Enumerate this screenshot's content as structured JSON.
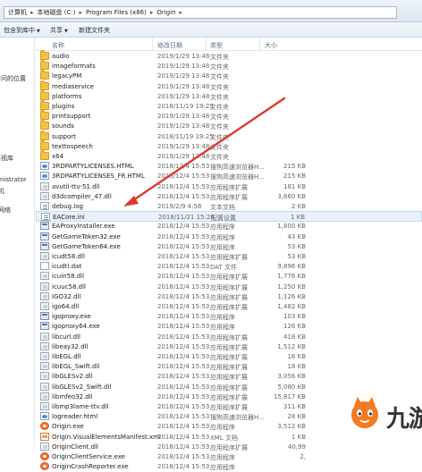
{
  "address_bar": {
    "segments": [
      "计算机",
      "本地磁盘 (C:)",
      "Program Files (x86)",
      "Origin"
    ]
  },
  "toolbar": {
    "items": [
      {
        "label": "包含到库中",
        "dropdown": true
      },
      {
        "label": "共享",
        "dropdown": true
      },
      {
        "label": "新建文件夹",
        "dropdown": false
      }
    ]
  },
  "nav": {
    "items": [
      "访问的位置",
      "影视库",
      "inistrator",
      "机",
      "网络"
    ]
  },
  "columns": {
    "name": "名称",
    "date": "修改日期",
    "type": "类型",
    "size": "大小"
  },
  "files": [
    {
      "name": "audio",
      "date": "2019/1/29 13:48",
      "type": "文件夹",
      "size": "",
      "icon": "folder-icon"
    },
    {
      "name": "imageformats",
      "date": "2019/1/29 13:48",
      "type": "文件夹",
      "size": "",
      "icon": "folder-icon"
    },
    {
      "name": "legacyPM",
      "date": "2019/1/29 13:48",
      "type": "文件夹",
      "size": "",
      "icon": "folder-icon"
    },
    {
      "name": "mediaservice",
      "date": "2019/1/29 13:48",
      "type": "文件夹",
      "size": "",
      "icon": "folder-icon"
    },
    {
      "name": "platforms",
      "date": "2019/1/29 13:48",
      "type": "文件夹",
      "size": "",
      "icon": "folder-icon"
    },
    {
      "name": "plugins",
      "date": "2018/11/19 19:25",
      "type": "文件夹",
      "size": "",
      "icon": "folder-icon"
    },
    {
      "name": "printsupport",
      "date": "2019/1/29 13:48",
      "type": "文件夹",
      "size": "",
      "icon": "folder-icon"
    },
    {
      "name": "sounds",
      "date": "2019/1/29 13:48",
      "type": "文件夹",
      "size": "",
      "icon": "folder-icon"
    },
    {
      "name": "support",
      "date": "2018/11/19 19:25",
      "type": "文件夹",
      "size": "",
      "icon": "folder-icon"
    },
    {
      "name": "texttospeech",
      "date": "2019/1/29 13:48",
      "type": "文件夹",
      "size": "",
      "icon": "folder-icon"
    },
    {
      "name": "x64",
      "date": "2019/1/29 13:48",
      "type": "文件夹",
      "size": "",
      "icon": "folder-icon"
    },
    {
      "name": "3RDPARTYLICENSES.HTML",
      "date": "2018/12/4 15:53",
      "type": "搜狗高速浏览器H...",
      "size": "215 KB",
      "icon": "html-icon"
    },
    {
      "name": "3RDPARTYLICENSES_FR.HTML",
      "date": "2018/12/4 15:53",
      "type": "搜狗高速浏览器H...",
      "size": "215 KB",
      "icon": "html-icon"
    },
    {
      "name": "avutil-ttv-51.dll",
      "date": "2018/12/4 15:53",
      "type": "应用程序扩展",
      "size": "181 KB",
      "icon": "dll-icon"
    },
    {
      "name": "d3dcompiler_47.dll",
      "date": "2018/12/4 15:53",
      "type": "应用程序扩展",
      "size": "3,660 KB",
      "icon": "dll-icon"
    },
    {
      "name": "debug.log",
      "date": "2019/2/9 4:58",
      "type": "文本文档",
      "size": "2 KB",
      "icon": "log-icon"
    },
    {
      "name": "EACore.ini",
      "date": "2018/11/21 15:28",
      "type": "配置设置",
      "size": "1 KB",
      "icon": "ini-icon"
    },
    {
      "name": "EAProxyInstaller.exe",
      "date": "2018/12/4 15:53",
      "type": "应用程序",
      "size": "1,800 KB",
      "icon": "exe-icon"
    },
    {
      "name": "GetGameToken32.exe",
      "date": "2018/12/4 15:53",
      "type": "应用程序",
      "size": "43 KB",
      "icon": "exe-icon"
    },
    {
      "name": "GetGameToken64.exe",
      "date": "2018/12/4 15:53",
      "type": "应用程序",
      "size": "53 KB",
      "icon": "exe-icon"
    },
    {
      "name": "icudt58.dll",
      "date": "2018/12/4 15:53",
      "type": "应用程序扩展",
      "size": "53 KB",
      "icon": "dll-icon"
    },
    {
      "name": "icudtl.dat",
      "date": "2018/12/4 15:53",
      "type": "DAT 文件",
      "size": "9,896 KB",
      "icon": "dat-icon"
    },
    {
      "name": "icuin58.dll",
      "date": "2018/12/4 15:53",
      "type": "应用程序扩展",
      "size": "1,776 KB",
      "icon": "dll-icon"
    },
    {
      "name": "icuuc58.dll",
      "date": "2018/12/4 15:53",
      "type": "应用程序扩展",
      "size": "1,250 KB",
      "icon": "dll-icon"
    },
    {
      "name": "IGO32.dll",
      "date": "2018/12/4 15:53",
      "type": "应用程序扩展",
      "size": "1,126 KB",
      "icon": "dll-icon"
    },
    {
      "name": "igo64.dll",
      "date": "2018/12/4 15:53",
      "type": "应用程序扩展",
      "size": "1,482 KB",
      "icon": "dll-icon"
    },
    {
      "name": "igoproxy.exe",
      "date": "2018/12/4 15:53",
      "type": "应用程序",
      "size": "103 KB",
      "icon": "exe-icon"
    },
    {
      "name": "igoproxy64.exe",
      "date": "2018/12/4 15:53",
      "type": "应用程序",
      "size": "126 KB",
      "icon": "exe-icon"
    },
    {
      "name": "libcurl.dll",
      "date": "2018/12/4 15:53",
      "type": "应用程序扩展",
      "size": "418 KB",
      "icon": "dll-icon"
    },
    {
      "name": "libeay32.dll",
      "date": "2018/12/4 15:53",
      "type": "应用程序扩展",
      "size": "1,512 KB",
      "icon": "dll-icon"
    },
    {
      "name": "libEGL.dll",
      "date": "2018/12/4 15:53",
      "type": "应用程序扩展",
      "size": "16 KB",
      "icon": "dll-icon"
    },
    {
      "name": "libEGL_Swift.dll",
      "date": "2018/12/4 15:53",
      "type": "应用程序扩展",
      "size": "18 KB",
      "icon": "dll-icon"
    },
    {
      "name": "libGLESv2.dll",
      "date": "2018/12/4 15:53",
      "type": "应用程序扩展",
      "size": "3,056 KB",
      "icon": "dll-icon"
    },
    {
      "name": "libGLESv2_Swift.dll",
      "date": "2018/12/4 15:53",
      "type": "应用程序扩展",
      "size": "5,080 KB",
      "icon": "dll-icon"
    },
    {
      "name": "libmfeo32.dll",
      "date": "2018/12/4 15:53",
      "type": "应用程序扩展",
      "size": "15,817 KB",
      "icon": "dll-icon"
    },
    {
      "name": "libmp3lame-ttv.dll",
      "date": "2018/12/4 15:53",
      "type": "应用程序扩展",
      "size": "311 KB",
      "icon": "dll-icon"
    },
    {
      "name": "logreader.html",
      "date": "2018/12/4 15:53",
      "type": "搜狗高速浏览器H...",
      "size": "28 KB",
      "icon": "html-icon"
    },
    {
      "name": "Origin.exe",
      "date": "2018/12/4 15:53",
      "type": "应用程序",
      "size": "3,512 KB",
      "icon": "origin-icon"
    },
    {
      "name": "Origin.VisualElementsManifest.xml",
      "date": "2018/12/4 15:53",
      "type": "XML 文档",
      "size": "1 KB",
      "icon": "xml-icon"
    },
    {
      "name": "OriginClient.dll",
      "date": "2018/12/4 15:53",
      "type": "应用程序扩展",
      "size": "40,99",
      "icon": "dll-icon"
    },
    {
      "name": "OriginClientService.exe",
      "date": "2018/12/4 15:53",
      "type": "应用程序",
      "size": "2,",
      "icon": "origin-icon"
    },
    {
      "name": "OriginCrashReporter.exe",
      "date": "2018/12/4 15:53",
      "type": "应用程序",
      "size": "",
      "icon": "origin-icon"
    }
  ],
  "selected_row": "EACore.ini",
  "annotation_arrow": {
    "color": "#e0392b",
    "points_to": "EACore.ini"
  },
  "watermark": {
    "text": "九游",
    "logo": "jiuyou-logo",
    "logo_color": "#f47a20"
  }
}
